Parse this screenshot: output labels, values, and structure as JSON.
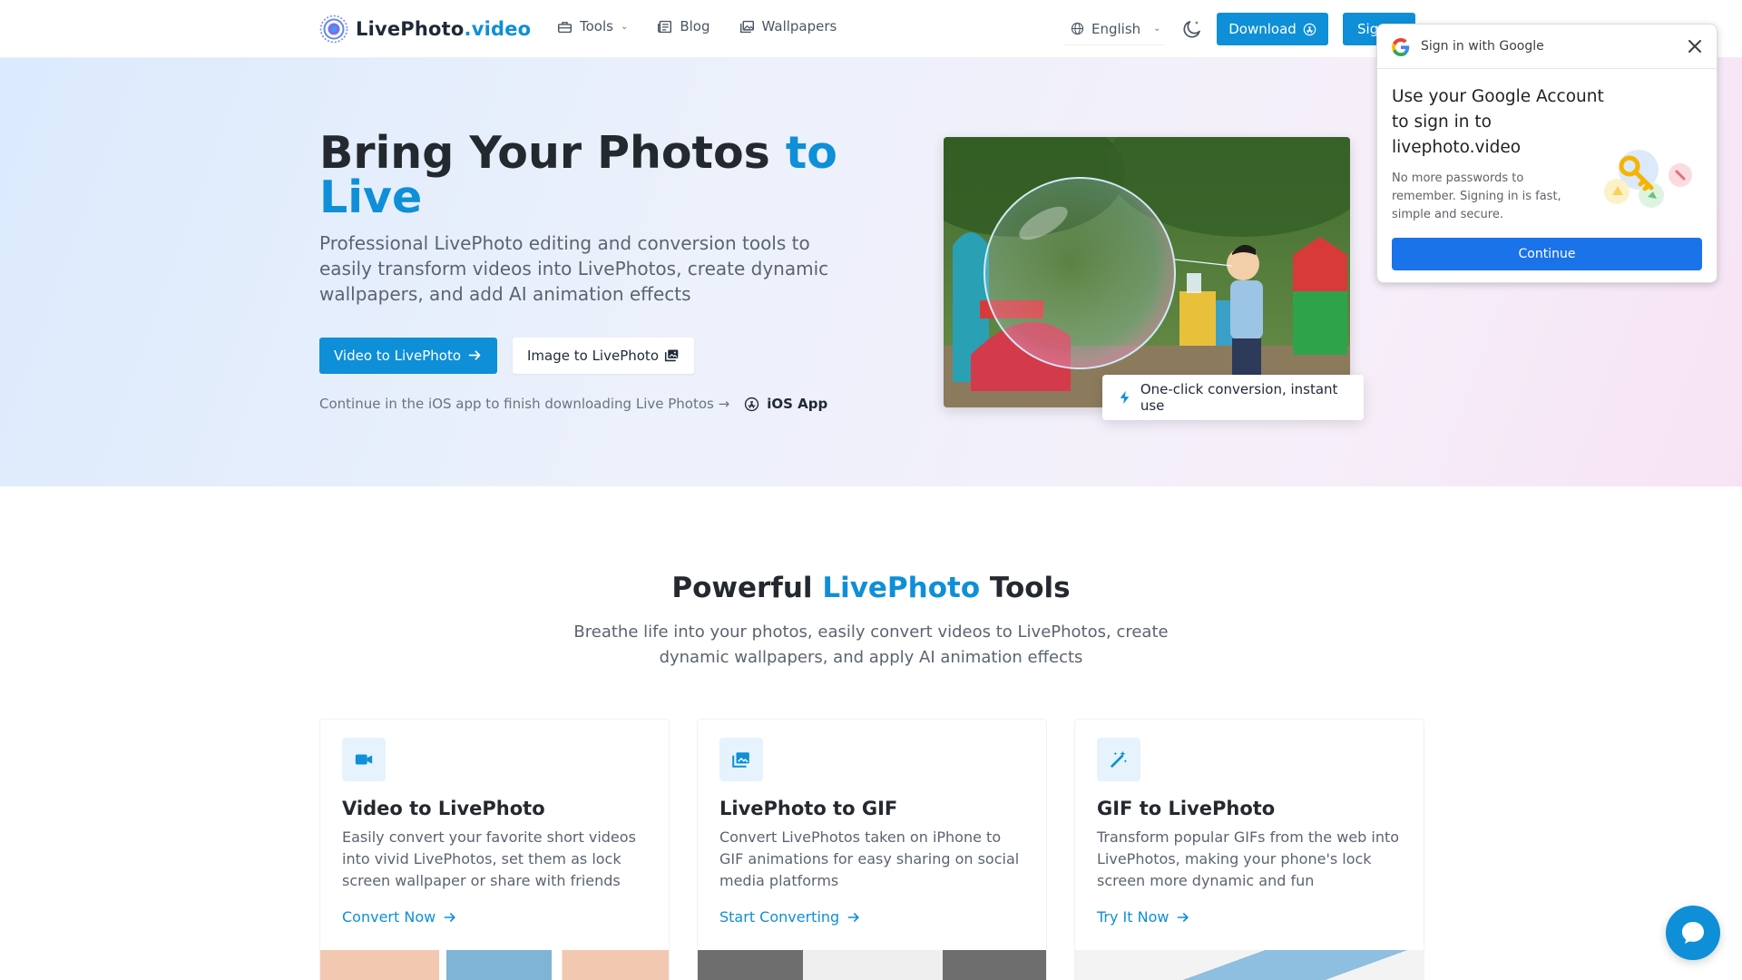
{
  "nav": {
    "logo_name": "LivePhoto",
    "logo_domain": ".video",
    "tools_label": "Tools",
    "blog_label": "Blog",
    "wallpapers_label": "Wallpapers",
    "language": "English",
    "download_label": "Download",
    "signin_label": "Sig"
  },
  "hero": {
    "title_part1": "Bring Your Photos ",
    "title_accent1": "to",
    "title_accent2": "Live",
    "subtitle": "Professional LivePhoto editing and conversion tools to easily transform videos into LivePhotos, create dynamic wallpapers, and add AI animation effects",
    "primary_button": "Video to LivePhoto",
    "secondary_button": "Image to LivePhoto",
    "ios_text": "Continue in the iOS app to finish downloading Live Photos →",
    "ios_app_label": "iOS App",
    "badge_text": "One-click conversion, instant use"
  },
  "tools": {
    "title_part1": "Powerful ",
    "title_accent": "LivePhoto",
    "title_part2": " Tools",
    "subtitle": "Breathe life into your photos, easily convert videos to LivePhotos, create dynamic wallpapers, and apply AI animation effects",
    "cards": [
      {
        "icon": "video-camera-icon",
        "title": "Video to LivePhoto",
        "desc": "Easily convert your favorite short videos into vivid LivePhotos, set them as lock screen wallpaper or share with friends",
        "link": "Convert Now"
      },
      {
        "icon": "images-icon",
        "title": "LivePhoto to GIF",
        "desc": "Convert LivePhotos taken on iPhone to GIF animations for easy sharing on social media platforms",
        "link": "Start Converting"
      },
      {
        "icon": "magic-wand-icon",
        "title": "GIF to LivePhoto",
        "desc": "Transform popular GIFs from the web into LivePhotos, making your phone's lock screen more dynamic and fun",
        "link": "Try It Now"
      }
    ]
  },
  "google_popup": {
    "header": "Sign in with Google",
    "heading": "Use your Google Account to sign in to livephoto.video",
    "body": "No more passwords to remember. Signing in is fast, simple and secure.",
    "button": "Continue"
  },
  "colors": {
    "accent": "#0e8fd8",
    "google_blue": "#1a73e8"
  }
}
